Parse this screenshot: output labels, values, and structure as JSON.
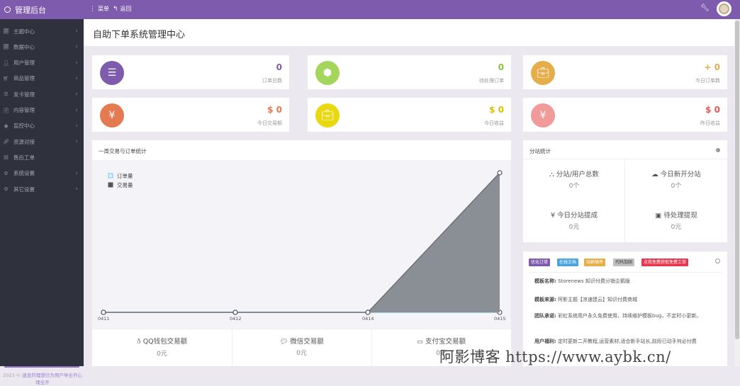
{
  "app": {
    "title": "管理后台"
  },
  "topbar": {
    "menu_label": "菜单",
    "back_label": "返回"
  },
  "sidebar": {
    "items": [
      {
        "label": "主题中心",
        "icon": "chart-icon",
        "chev": true
      },
      {
        "label": "数据中心",
        "icon": "chart-icon",
        "chev": true
      },
      {
        "label": "用户管理",
        "icon": "user-icon",
        "chev": true
      },
      {
        "label": "商品管理",
        "icon": "cart-icon",
        "chev": true
      },
      {
        "label": "发卡管理",
        "icon": "list-icon",
        "chev": true
      },
      {
        "label": "内容管理",
        "icon": "doc-icon",
        "chev": true
      },
      {
        "label": "监控中心",
        "icon": "eye-icon",
        "chev": true
      },
      {
        "label": "资源对接",
        "icon": "link-icon",
        "chev": true
      },
      {
        "label": "售后工单",
        "icon": "ticket-icon",
        "chev": false
      },
      {
        "label": "系统设置",
        "icon": "gear-icon",
        "chev": true
      },
      {
        "label": "其它设置",
        "icon": "gears-icon",
        "chev": true
      }
    ],
    "footer_year": "2023 ©",
    "footer_link": "速显的理想已为用户导全开心理全开"
  },
  "page": {
    "title": "自助下单系统管理中心"
  },
  "stats": [
    {
      "value": "0",
      "label": "订单总数",
      "color": "#7e5bad",
      "value_color": "#7e5bad",
      "icon": "list-icon"
    },
    {
      "value": "0",
      "label": "待处理订单",
      "color": "#a3d65a",
      "value_color": "#8dc63f",
      "icon": "cube-icon"
    },
    {
      "value": "+ 0",
      "label": "今日订单数",
      "color": "#e5ae4b",
      "value_color": "#e5ae4b",
      "icon": "briefcase-icon"
    },
    {
      "value": "$ 0",
      "label": "今日交易额",
      "color": "#e47a4f",
      "value_color": "#e47a4f",
      "icon": "yen-icon"
    },
    {
      "value": "$ 0",
      "label": "今日收益",
      "color": "#e9d80f",
      "value_color": "#d9c300",
      "icon": "briefcase-icon"
    },
    {
      "value": "$ 0",
      "label": "昨日收益",
      "color": "#f19a9a",
      "value_color": "#e85a5a",
      "icon": "yen-icon"
    }
  ],
  "chart_panel": {
    "title": "一周交易与订单统计"
  },
  "chart_data": {
    "type": "area",
    "categories": [
      "0411",
      "0412",
      "0414",
      "0415"
    ],
    "series": [
      {
        "name": "订单量",
        "values": [
          0,
          0,
          0,
          0
        ],
        "color": "#7ec8e3"
      },
      {
        "name": "交易量",
        "values": [
          0,
          0,
          0,
          1
        ],
        "color": "#8a8e95"
      }
    ],
    "legend_position": "top-left"
  },
  "payments": [
    {
      "label": "QQ钱包交易额",
      "value": "0元",
      "icon": "qq-icon"
    },
    {
      "label": "微信交易额",
      "value": "0元",
      "icon": "wechat-icon"
    },
    {
      "label": "支付宝交易额",
      "value": "0元",
      "icon": "alipay-icon"
    }
  ],
  "dist": {
    "title": "分站统计",
    "items": [
      {
        "label": "分站/用户总数",
        "value": "0个",
        "icon": "sitemap-icon"
      },
      {
        "label": "今日新开分站",
        "value": "0个",
        "icon": "cloud-icon"
      },
      {
        "label": "今日分站提成",
        "value": "0元",
        "icon": "yen-icon"
      },
      {
        "label": "待处理提现",
        "value": "0元",
        "icon": "card-icon"
      }
    ]
  },
  "info": {
    "badges": [
      {
        "label": "优化订单",
        "color": "#7e5bad"
      },
      {
        "label": "在线文档",
        "color": "#4aa3df"
      },
      {
        "label": "站群插件",
        "color": "#e5ae4b"
      },
      {
        "label": "代码加固",
        "color": "#bfbfbf"
      },
      {
        "label": "点我免费获取免费工单",
        "color": "#e8384f"
      }
    ],
    "rows": [
      {
        "k": "模板名称:",
        "v": "Storenews 知识付费分销企鹅版"
      },
      {
        "k": "模板来源:",
        "v": "阿影主题【凉速建云】知识付费商城"
      },
      {
        "k": "团队承诺:",
        "v": "彩虹系统用户永久免费使用，持续维护模板bug，不定时小更新。"
      },
      {
        "k": "用户福利:",
        "v": "定时更新二开教程,运营素材,适合新手站长,前段已动手何必付费"
      }
    ]
  },
  "watermark": "阿影博客 https://www.aybk.cn/"
}
